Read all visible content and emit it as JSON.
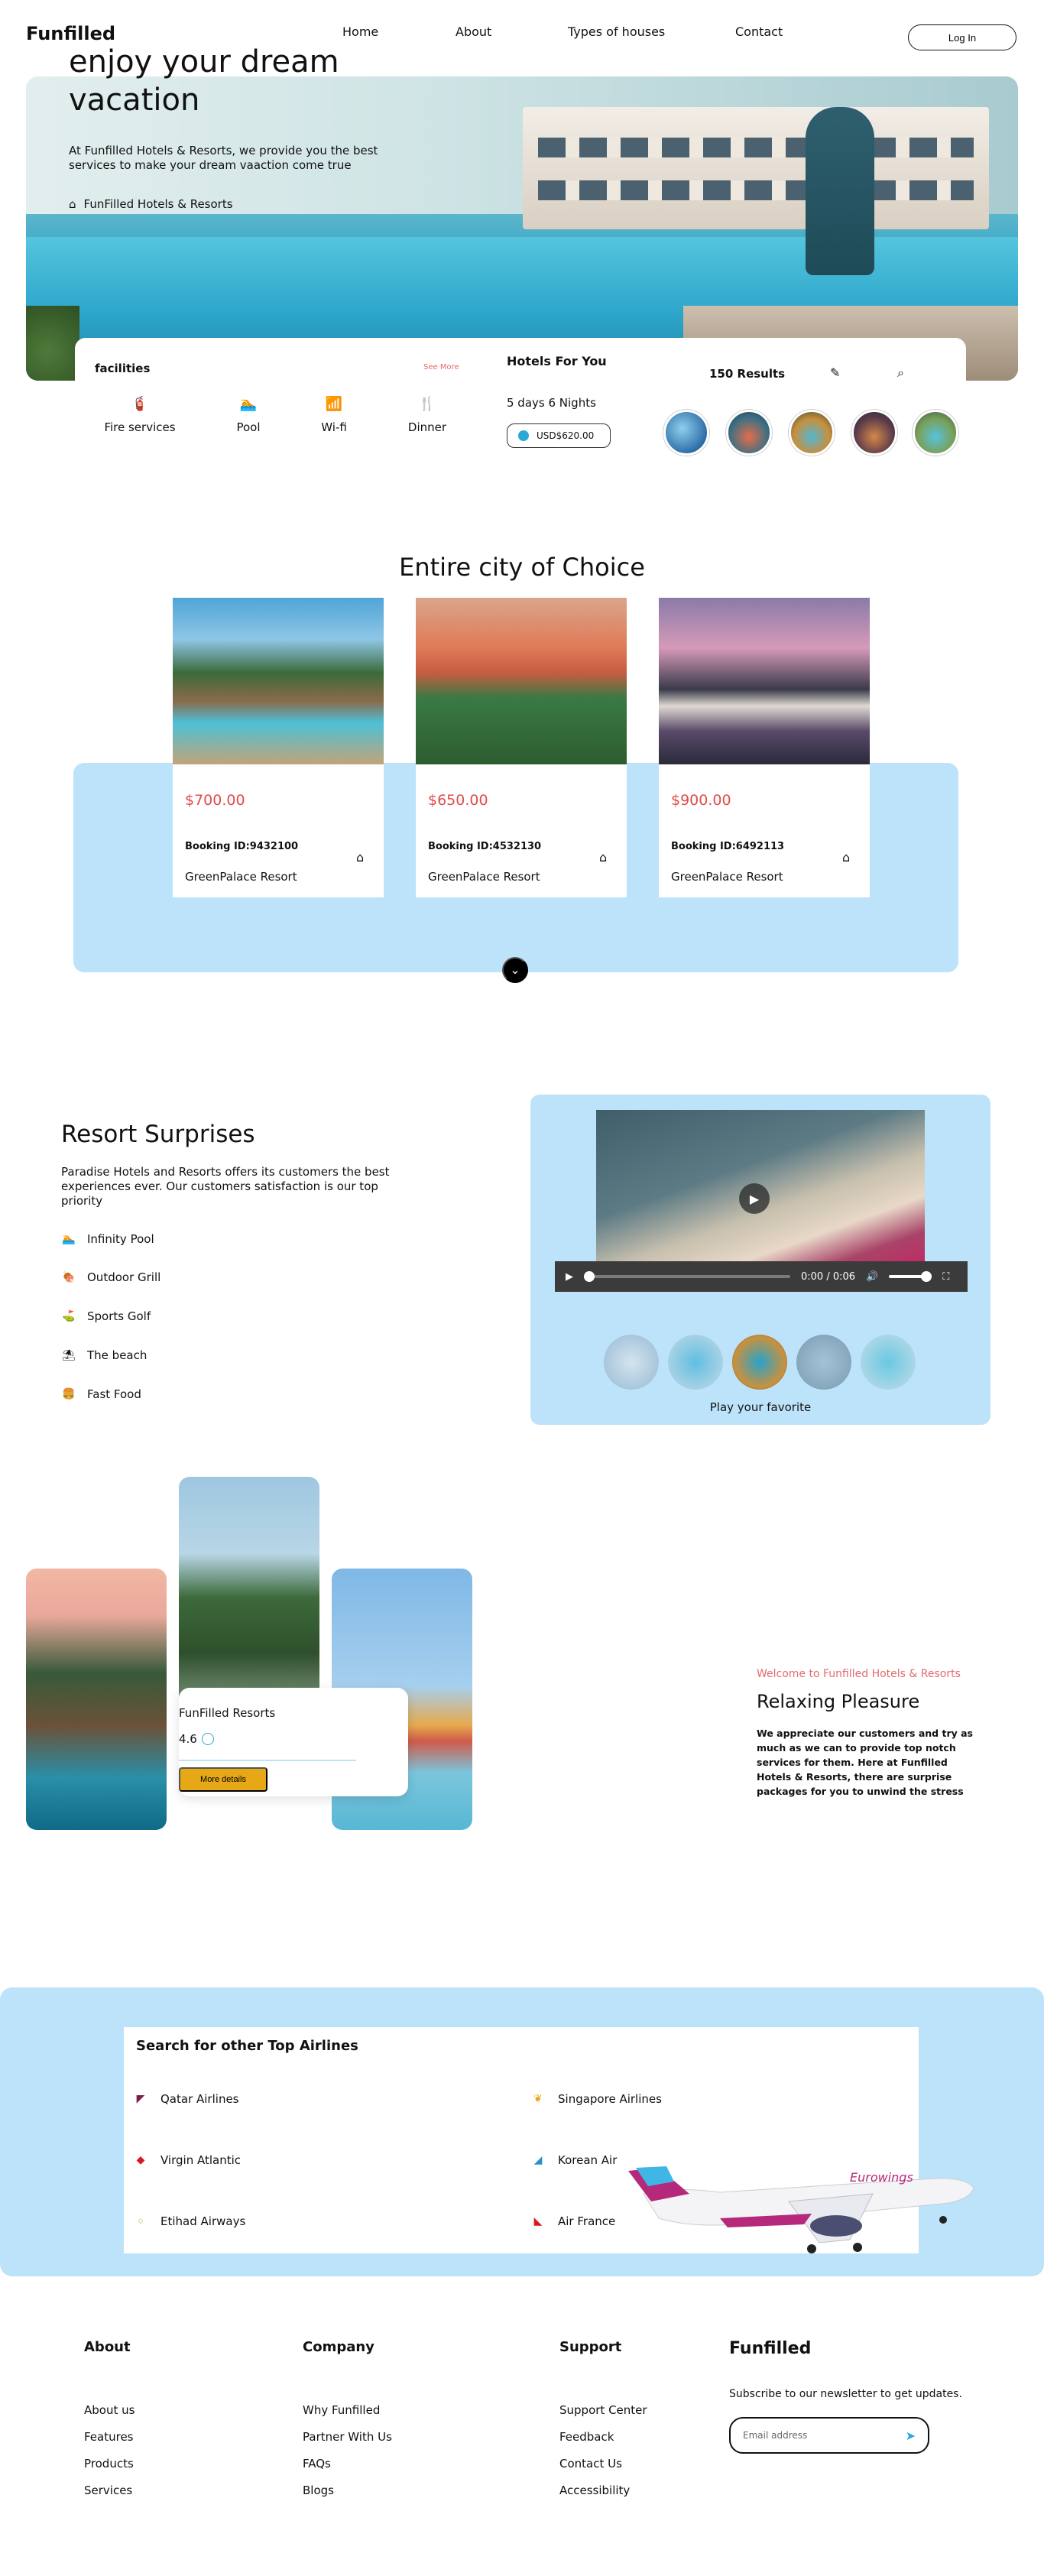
{
  "nav": {
    "logo": "Funfilled",
    "links": [
      "Home",
      "About",
      "Types of houses",
      "Contact"
    ],
    "login": "Log In"
  },
  "hero": {
    "title": "enjoy your dream vacation",
    "subtitle": "At Funfilled Hotels & Resorts, we provide you the best services to make your dream vaaction come true",
    "brand": "FunFilled Hotels & Resorts",
    "icons": {
      "brand": "home-icon"
    }
  },
  "filter": {
    "facilities_title": "facilities",
    "see_more": "See More",
    "facilities": [
      {
        "icon": "fire-extinguisher-icon",
        "glyph": "🧯",
        "label": "Fire services"
      },
      {
        "icon": "swimmer-icon",
        "glyph": "🏊",
        "label": "Pool"
      },
      {
        "icon": "wifi-icon",
        "glyph": "📶",
        "label": "Wi-fi"
      },
      {
        "icon": "utensils-icon",
        "glyph": "🍴",
        "label": "Dinner"
      }
    ],
    "hotels_title": "Hotels For You",
    "duration": "5 days 6 Nights",
    "price": "USD$620.00",
    "results": "150 Results",
    "icons": {
      "edit": "pencil-icon",
      "search": "search-icon"
    }
  },
  "city": {
    "title": "Entire city of Choice",
    "cards": [
      {
        "price": "$700.00",
        "booking": "Booking ID:9432100",
        "name": "GreenPalace Resort"
      },
      {
        "price": "$650.00",
        "booking": "Booking ID:4532130",
        "name": "GreenPalace Resort"
      },
      {
        "price": "$900.00",
        "booking": "Booking ID:6492113",
        "name": "GreenPalace Resort"
      }
    ]
  },
  "resort": {
    "title": "Resort Surprises",
    "text": "Paradise Hotels and Resorts offers its customers the best experiences ever. Our customers satisfaction is our top priority",
    "items": [
      {
        "icon": "swimmer-icon",
        "glyph": "🏊",
        "label": "Infinity Pool"
      },
      {
        "icon": "grill-icon",
        "glyph": "🍖",
        "label": "Outdoor Grill"
      },
      {
        "icon": "golf-icon",
        "glyph": "⛳",
        "label": "Sports Golf"
      },
      {
        "icon": "umbrella-beach-icon",
        "glyph": "⛱",
        "label": "The beach"
      },
      {
        "icon": "hamburger-icon",
        "glyph": "🍔",
        "label": "Fast Food"
      }
    ],
    "video": {
      "time": "0:00 / 0:06"
    },
    "play_favorite": "Play your favorite"
  },
  "gallery": {
    "card_name": "FunFilled Resorts",
    "rating": "4.6",
    "more": "More details",
    "welcome": "Welcome to Funfilled Hotels & Resorts",
    "heading": "Relaxing Pleasure",
    "text": "We appreciate our customers and try as much as we can to provide top notch services for them. Here at Funfilled Hotels & Resorts, there are surprise packages for you to unwind the stress"
  },
  "airlines": {
    "title": "Search for other Top Airlines",
    "list": [
      {
        "name": "Qatar Airlines",
        "color": "#7b1c4a"
      },
      {
        "name": "Singapore Airlines",
        "color": "#e6a817"
      },
      {
        "name": "Virgin Atlantic",
        "color": "#d71920"
      },
      {
        "name": "Korean Air",
        "color": "#2a8fd0"
      },
      {
        "name": "Etihad Airways",
        "color": "#c8a46a"
      },
      {
        "name": "Air France",
        "color": "#d71920"
      }
    ]
  },
  "footer": {
    "columns": [
      {
        "title": "About",
        "links": [
          "About us",
          "Features",
          "Products",
          "Services"
        ]
      },
      {
        "title": "Company",
        "links": [
          "Why Funfilled",
          "Partner With Us",
          "FAQs",
          "Blogs"
        ]
      },
      {
        "title": "Support",
        "links": [
          "Support Center",
          "Feedback",
          "Contact Us",
          "Accessibility"
        ]
      }
    ],
    "brand": "Funfilled",
    "subscribe": "Subscribe to our newsletter to get updates.",
    "email_placeholder": "Email address"
  },
  "colors": {
    "accent_blue": "#bde3fb",
    "price_red": "#e24b4b",
    "button_gold": "#e6a817",
    "welcome_pink": "#e36b6b"
  }
}
